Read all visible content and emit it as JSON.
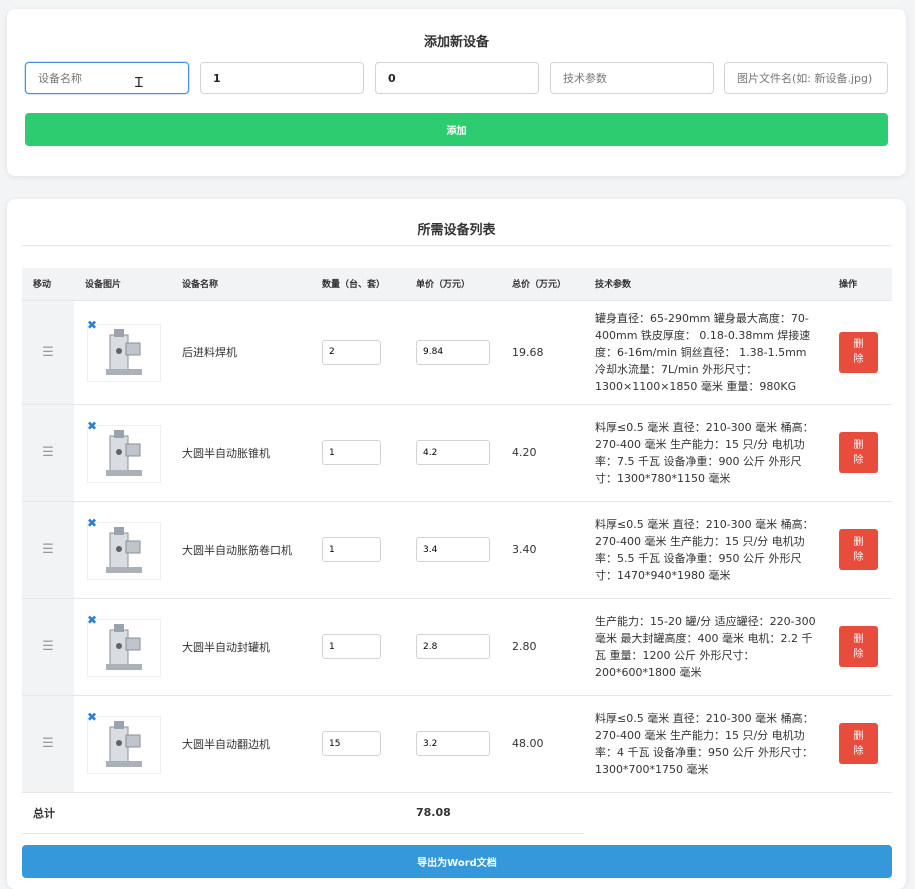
{
  "add_form": {
    "title": "添加新设备",
    "name_placeholder": "设备名称",
    "quantity_value": "1",
    "price_value": "0",
    "spec_placeholder": "技术参数",
    "image_placeholder": "图片文件名(如: 新设备.jpg)",
    "add_button": "添加"
  },
  "list": {
    "title": "所需设备列表",
    "columns": [
      "移动",
      "设备图片",
      "设备名称",
      "数量（台、套）",
      "单价（万元）",
      "总价（万元）",
      "技术参数",
      "操作"
    ],
    "rows": [
      {
        "name": "后进料焊机",
        "quantity": "2",
        "unit_price": "9.84",
        "total": "19.68",
        "spec": "罐身直径：65-290mm 罐身最大高度：70-400mm 铁皮厚度： 0.18-0.38mm 焊接速度：6-16m/min 铜丝直径： 1.38-1.5mm 冷却水流量：7L/min 外形尺寸：1300×1100×1850 毫米 重量：980KG",
        "delete_label": "删除"
      },
      {
        "name": "大圆半自动胀锥机",
        "quantity": "1",
        "unit_price": "4.2",
        "total": "4.20",
        "spec": "料厚≤0.5 毫米 直径：210-300 毫米 桶高：270-400 毫米 生产能力：15 只/分 电机功率：7.5 千瓦 设备净重：900 公斤 外形尺寸：1300*780*1150 毫米",
        "delete_label": "删除"
      },
      {
        "name": "大圆半自动胀筋卷口机",
        "quantity": "1",
        "unit_price": "3.4",
        "total": "3.40",
        "spec": "料厚≤0.5 毫米 直径：210-300 毫米 桶高：270-400 毫米 生产能力：15 只/分 电机功率：5.5 千瓦 设备净重：950 公斤 外形尺寸：1470*940*1980 毫米",
        "delete_label": "删除"
      },
      {
        "name": "大圆半自动封罐机",
        "quantity": "1",
        "unit_price": "2.8",
        "total": "2.80",
        "spec": "生产能力：15-20 罐/分 适应罐径：220-300 毫米 最大封罐高度：400 毫米 电机：2.2 千瓦 重量：1200 公斤 外形尺寸：200*600*1800 毫米",
        "delete_label": "删除"
      },
      {
        "name": "大圆半自动翻边机",
        "quantity": "15",
        "unit_price": "3.2",
        "total": "48.00",
        "spec": "料厚≤0.5 毫米 直径：210-300 毫米 桶高：270-400 毫米 生产能力：15 只/分 电机功率：4 千瓦 设备净重：950 公斤 外形尺寸：1300*700*1750 毫米",
        "delete_label": "删除"
      }
    ],
    "total_label": "总计",
    "total_value": "78.08",
    "export_button": "导出为Word文档"
  },
  "icons": {
    "drag_handle": "drag-handle-icon",
    "image_remove": "close-icon"
  },
  "colors": {
    "add_button": "#2ecc71",
    "export_button": "#3498db",
    "delete_button": "#e74c3c",
    "image_remove_icon": "#2d7fd3",
    "focused_border": "#4a90e2"
  }
}
